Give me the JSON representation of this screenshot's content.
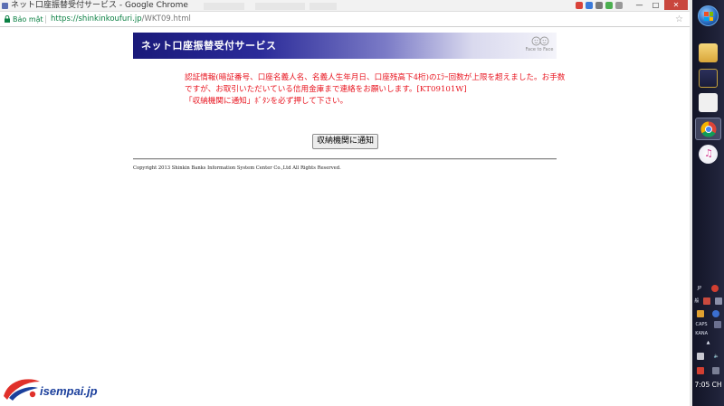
{
  "browser": {
    "window_title": "ネット口座振替受付サービス - Google Chrome",
    "security_label": "Bảo mật",
    "url_host": "https://shinkinkoufuri.jp",
    "url_path": "/WKT09.html",
    "window_controls": {
      "minimize_icon": "minimize-icon",
      "maximize_icon": "maximize-icon",
      "close_icon": "close-icon"
    }
  },
  "page": {
    "banner_title": "ネット口座振替受付サービス",
    "logo_text": "Face to Face",
    "error_lines": [
      "認証情報(暗証番号、口座名義人名、名義人生年月日、口座残高下4桁)のｴﾗｰ回数が上限を超えました。お手数",
      "ですが、お取引いただいている信用金庫まで連絡をお願いします。[KT09101W]",
      "「収納機関に通知」ﾎﾞﾀﾝを必ず押して下さい。"
    ],
    "notify_button_label": "収納機関に通知",
    "copyright": "Copyright 2013 Shinkin Banks Information System Center Co.,Ltd All Rights Reserved."
  },
  "watermark": {
    "text": "isempai.jp"
  },
  "taskbar": {
    "language": "JP",
    "ime_mode": "般",
    "caps_label": "CAPS",
    "kana_label": "KANA",
    "clock": "7:05 CH"
  },
  "colors": {
    "error_text": "#e8141f",
    "banner_dark": "#1a1a7a",
    "secure_green": "#0b8043",
    "watermark_blue": "#1b3f9c",
    "watermark_red": "#e0302a"
  }
}
